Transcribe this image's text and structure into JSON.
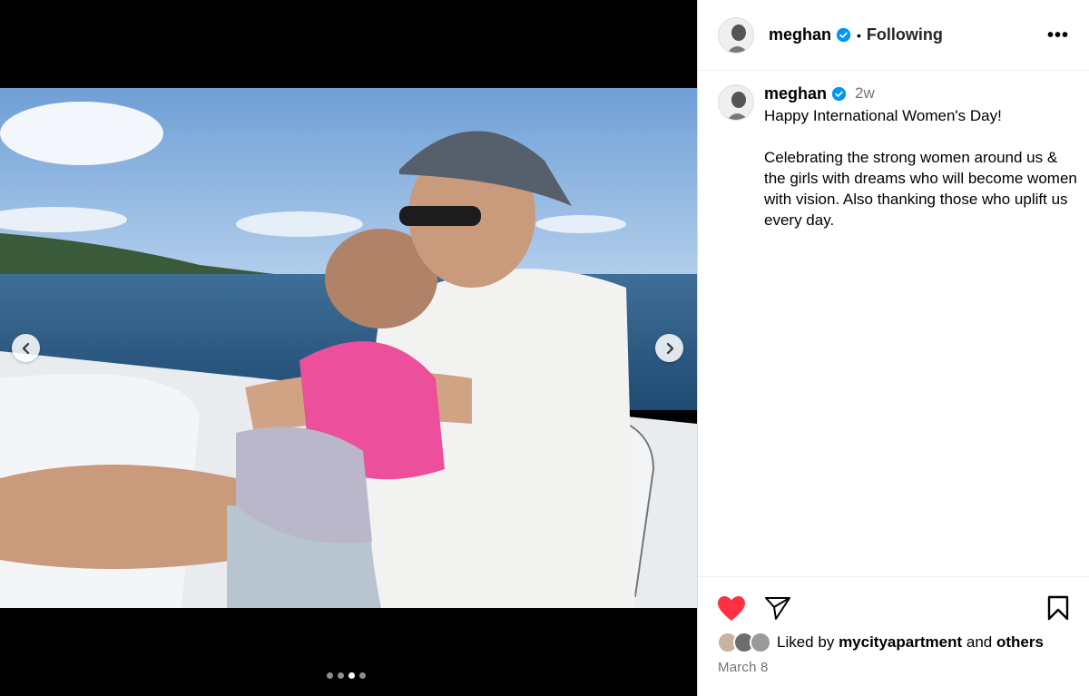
{
  "header": {
    "username": "meghan",
    "separator": "•",
    "follow_status": "Following",
    "more_icon": "more-horizontal-icon"
  },
  "caption": {
    "username": "meghan",
    "time_ago": "2w",
    "text": "Happy International Women's Day!\n\nCelebrating the strong women around us & the girls with dreams who will become women with vision. Also thanking those who uplift us every day."
  },
  "media": {
    "carousel_count": 4,
    "carousel_active_index": 2,
    "prev_icon": "chevron-left-icon",
    "next_icon": "chevron-right-icon"
  },
  "actions": {
    "like_icon": "heart-filled-icon",
    "share_icon": "paper-plane-icon",
    "save_icon": "bookmark-icon",
    "liked_prefix": "Liked by",
    "liked_user": "mycityapartment",
    "liked_and": "and",
    "liked_others": "others",
    "date": "March 8"
  },
  "colors": {
    "like_red": "#ff3040",
    "verified_blue": "#0095f6",
    "secondary_text": "#737373"
  }
}
